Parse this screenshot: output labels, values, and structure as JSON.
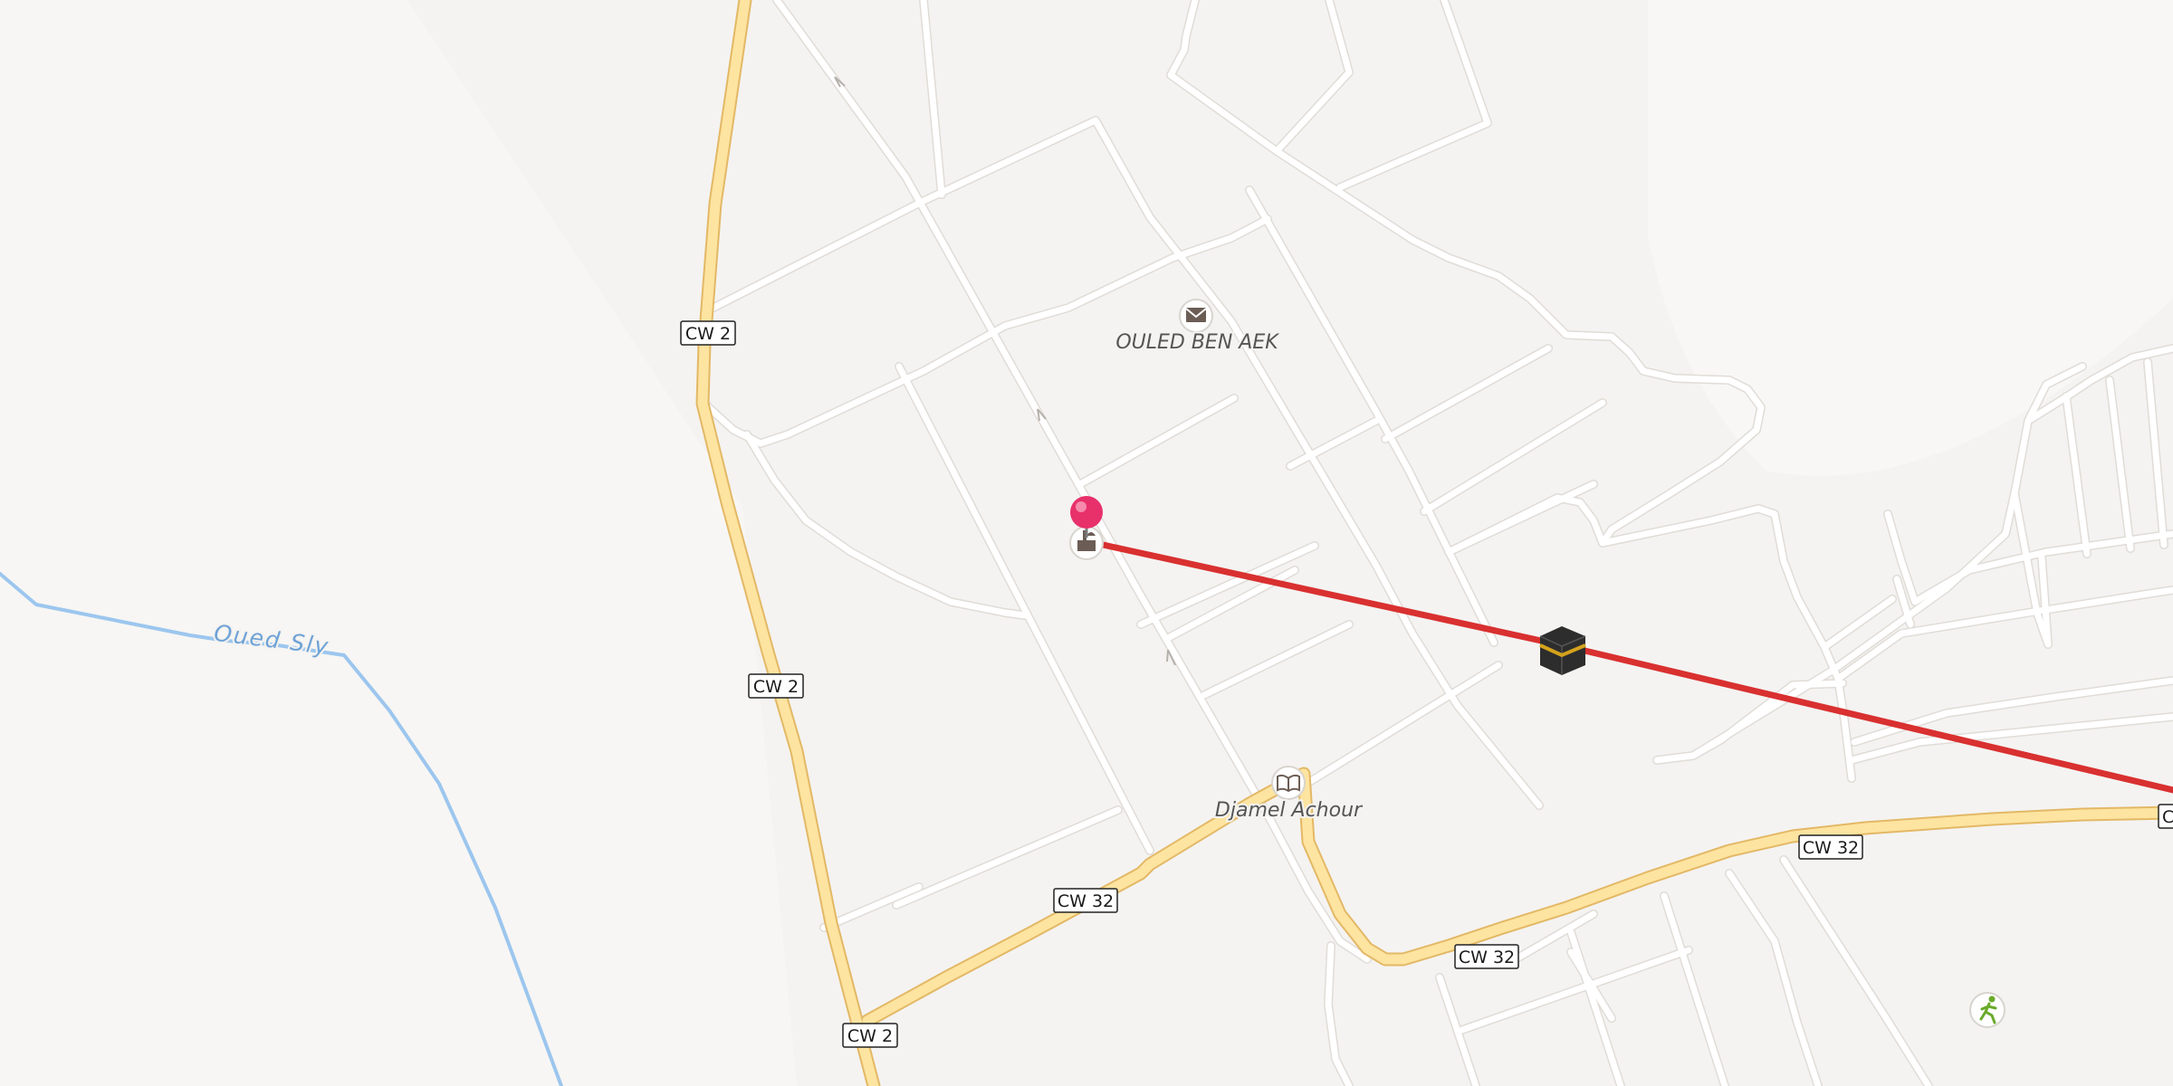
{
  "map": {
    "colors": {
      "background": "#f4f3f1",
      "main_road": "#fde4a0",
      "minor_road": "#ffffff",
      "river": "#9cc6ee",
      "route": "#d93030",
      "pin": "#e8306a"
    },
    "route_shields": [
      {
        "id": "cw2-north",
        "text": "CW 2"
      },
      {
        "id": "cw2-mid",
        "text": "CW 2"
      },
      {
        "id": "cw2-south",
        "text": "CW 2"
      },
      {
        "id": "cw32-west",
        "text": "CW 32"
      },
      {
        "id": "cw32-center",
        "text": "CW 32"
      },
      {
        "id": "cw32-east",
        "text": "CW 32"
      },
      {
        "id": "cw-edge",
        "text": "C"
      }
    ],
    "places": {
      "post_office": {
        "label": "OULED BEN AEK",
        "icon": "envelope-icon"
      },
      "school": {
        "label": "Djamel Achour",
        "icon": "open-book-icon"
      }
    },
    "water": {
      "label": "Oued Sly"
    },
    "markers": {
      "pin": {
        "icon": "map-pin-icon"
      },
      "mosque": {
        "icon": "mosque-icon"
      },
      "kaaba": {
        "icon": "kaaba-icon"
      },
      "sports": {
        "icon": "running-person-icon"
      }
    }
  }
}
